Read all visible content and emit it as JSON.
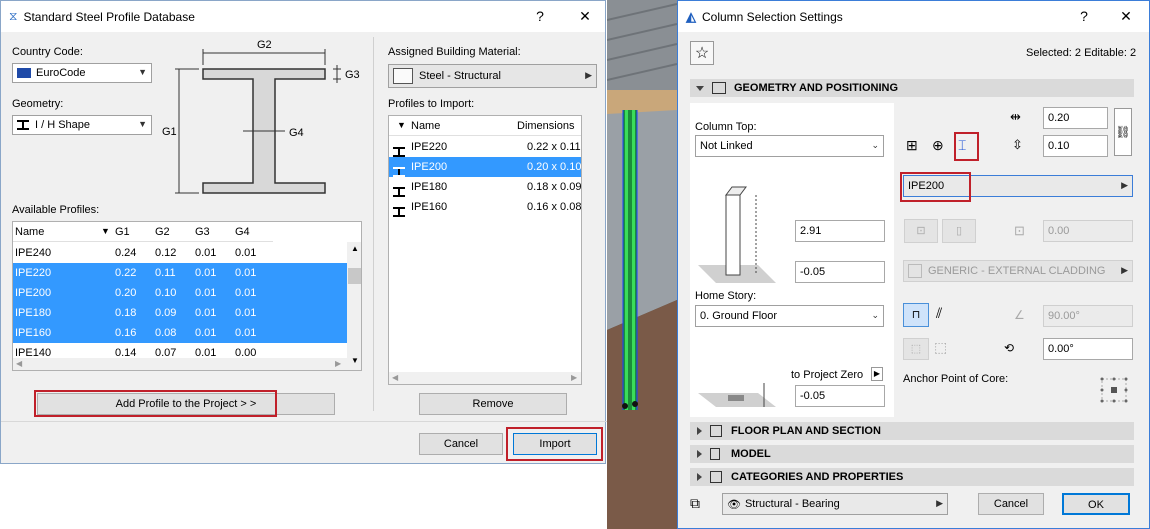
{
  "left_dialog": {
    "title": "Standard Steel Profile Database",
    "help": "?",
    "close": "✕",
    "country_code_label": "Country Code:",
    "country_code_value": "EuroCode",
    "geometry_label": "Geometry:",
    "geometry_value": "I / H Shape",
    "diagram_labels": {
      "g1": "G1",
      "g2": "G2",
      "g3": "G3",
      "g4": "G4"
    },
    "available_profiles_label": "Available Profiles:",
    "available_columns": [
      "Name",
      "G1",
      "G2",
      "G3",
      "G4"
    ],
    "available_rows": [
      {
        "name": "IPE240",
        "g1": "0.24",
        "g2": "0.12",
        "g3": "0.01",
        "g4": "0.01",
        "selected": false
      },
      {
        "name": "IPE220",
        "g1": "0.22",
        "g2": "0.11",
        "g3": "0.01",
        "g4": "0.01",
        "selected": true
      },
      {
        "name": "IPE200",
        "g1": "0.20",
        "g2": "0.10",
        "g3": "0.01",
        "g4": "0.01",
        "selected": true
      },
      {
        "name": "IPE180",
        "g1": "0.18",
        "g2": "0.09",
        "g3": "0.01",
        "g4": "0.01",
        "selected": true
      },
      {
        "name": "IPE160",
        "g1": "0.16",
        "g2": "0.08",
        "g3": "0.01",
        "g4": "0.01",
        "selected": true
      },
      {
        "name": "IPE140",
        "g1": "0.14",
        "g2": "0.07",
        "g3": "0.01",
        "g4": "0.00",
        "selected": false
      }
    ],
    "add_profile_button": "Add Profile to the Project > >",
    "assigned_material_label": "Assigned Building Material:",
    "assigned_material_value": "Steel - Structural",
    "profiles_to_import_label": "Profiles to Import:",
    "import_columns": [
      "Name",
      "Dimensions"
    ],
    "import_rows": [
      {
        "name": "IPE220",
        "dim": "0.22 x 0.11",
        "selected": false
      },
      {
        "name": "IPE200",
        "dim": "0.20 x 0.10",
        "selected": true
      },
      {
        "name": "IPE180",
        "dim": "0.18 x 0.09",
        "selected": false
      },
      {
        "name": "IPE160",
        "dim": "0.16 x 0.08",
        "selected": false
      }
    ],
    "remove_button": "Remove",
    "cancel_button": "Cancel",
    "import_button": "Import"
  },
  "right_dialog": {
    "title": "Column Selection Settings",
    "help": "?",
    "close": "✕",
    "selected_info": "Selected: 2 Editable: 2",
    "sections": {
      "geometry": "GEOMETRY AND POSITIONING",
      "floor_plan": "FLOOR PLAN AND SECTION",
      "model": "MODEL",
      "categories": "CATEGORIES AND PROPERTIES"
    },
    "column_top_label": "Column Top:",
    "column_top_value": "Not Linked",
    "height_value": "2.91",
    "bottom_offset_value": "-0.05",
    "home_story_label": "Home Story:",
    "home_story_value": "0. Ground Floor",
    "to_project_zero_label": "to Project Zero",
    "project_zero_value": "-0.05",
    "width_value": "0.20",
    "depth_value": "0.10",
    "profile_value": "IPE200",
    "veneer_value": "0.00",
    "surface_value": "GENERIC - EXTERNAL CLADDING",
    "slant_angle_value": "90.00°",
    "rotation_value": "0.00°",
    "anchor_label": "Anchor Point of Core:",
    "layer_value": "Structural - Bearing",
    "cancel_button": "Cancel",
    "ok_button": "OK"
  }
}
